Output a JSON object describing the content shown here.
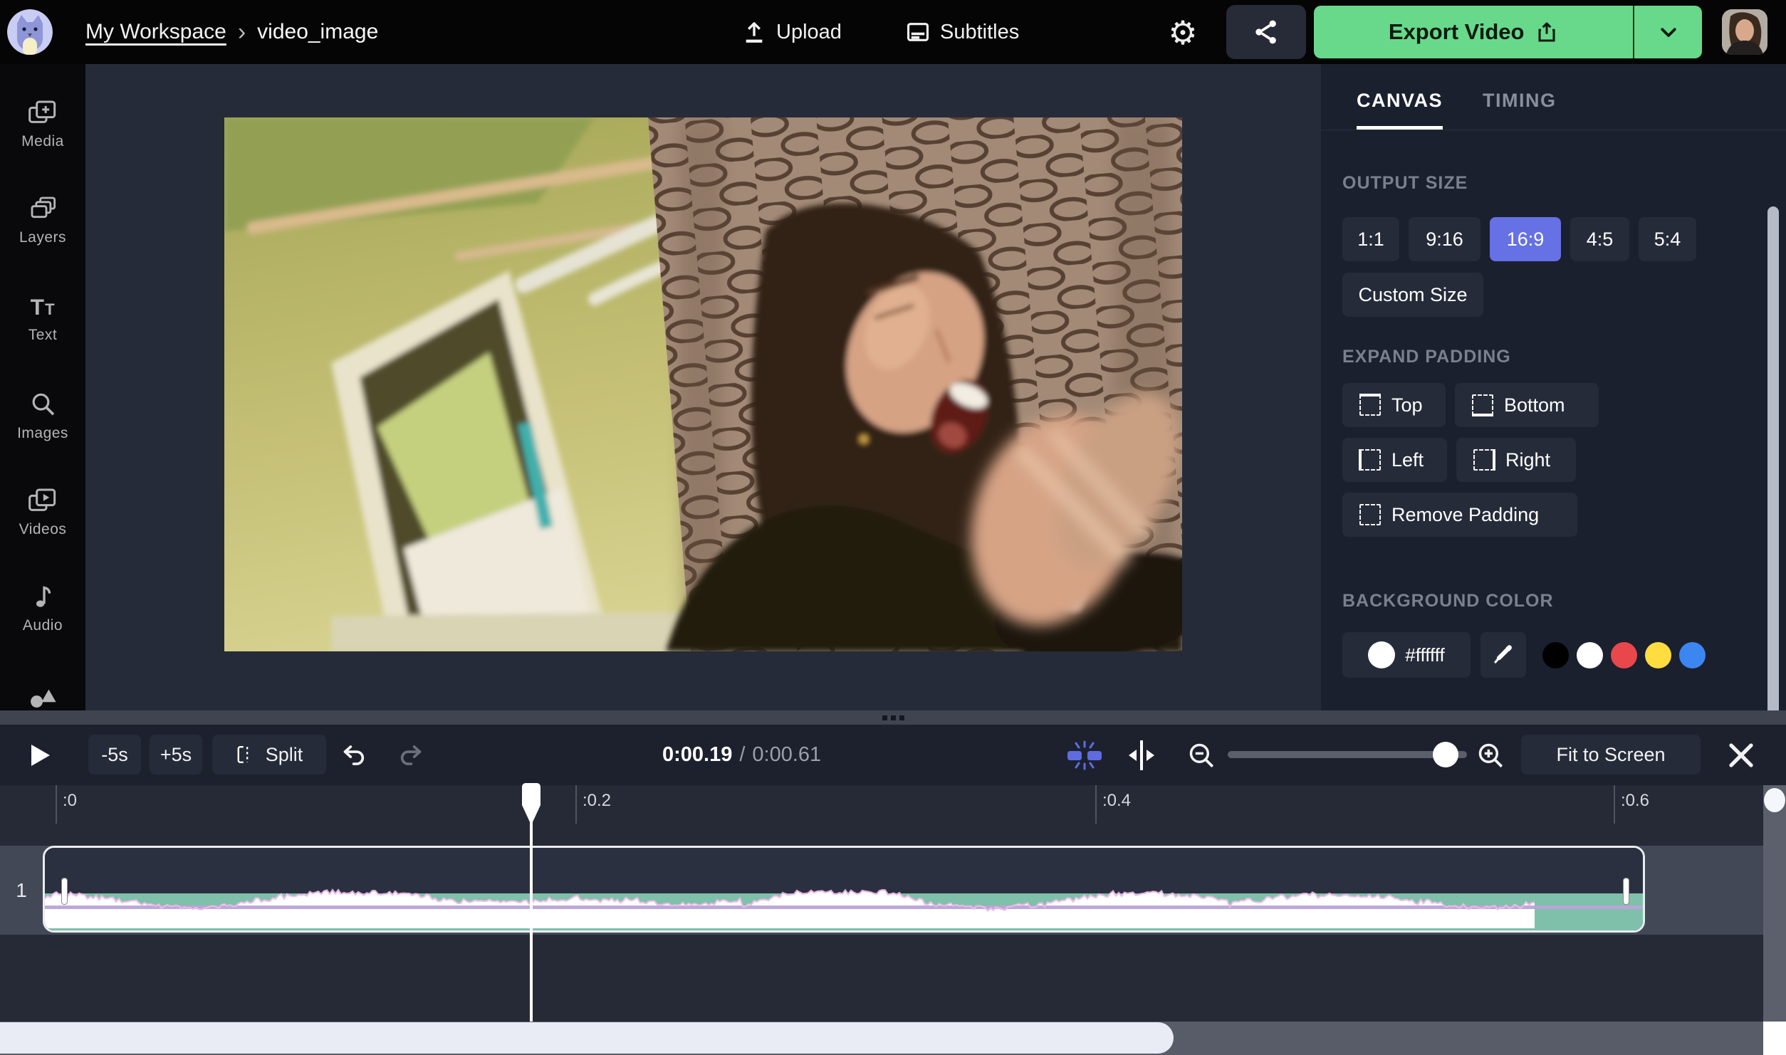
{
  "topbar": {
    "workspace": "My Workspace",
    "sep": "›",
    "project": "video_image",
    "upload": "Upload",
    "subtitles": "Subtitles",
    "export": "Export Video"
  },
  "sidebar": {
    "items": [
      {
        "label": "Media"
      },
      {
        "label": "Layers"
      },
      {
        "label": "Text"
      },
      {
        "label": "Images"
      },
      {
        "label": "Videos"
      },
      {
        "label": "Audio"
      }
    ]
  },
  "panel": {
    "tab_canvas": "CANVAS",
    "tab_timing": "TIMING",
    "output": {
      "title": "OUTPUT SIZE",
      "ratios": [
        "1:1",
        "9:16",
        "16:9",
        "4:5",
        "5:4"
      ],
      "selected": "16:9",
      "custom": "Custom Size"
    },
    "padding": {
      "title": "EXPAND PADDING",
      "top": "Top",
      "bottom": "Bottom",
      "left": "Left",
      "right": "Right",
      "remove": "Remove Padding"
    },
    "background": {
      "title": "BACKGROUND COLOR",
      "hex": "#ffffff",
      "swatches": [
        "#000000",
        "#ffffff",
        "#e8474b",
        "#ffdd40",
        "#3c86f2"
      ]
    }
  },
  "toolbar": {
    "back": "-5s",
    "fwd": "+5s",
    "split": "Split",
    "current": "0:00.19",
    "sep": "/",
    "total": "0:00.61",
    "fit": "Fit to Screen"
  },
  "timeline": {
    "ticks": [
      ":0",
      ":0.2",
      ":0.4",
      ":0.6"
    ],
    "track": "1"
  },
  "colors": {
    "accent_green": "#68d98b",
    "accent_blue": "#6571e4",
    "clip_teal": "#7fc0aa",
    "volume_line": "#b9a3d8"
  }
}
